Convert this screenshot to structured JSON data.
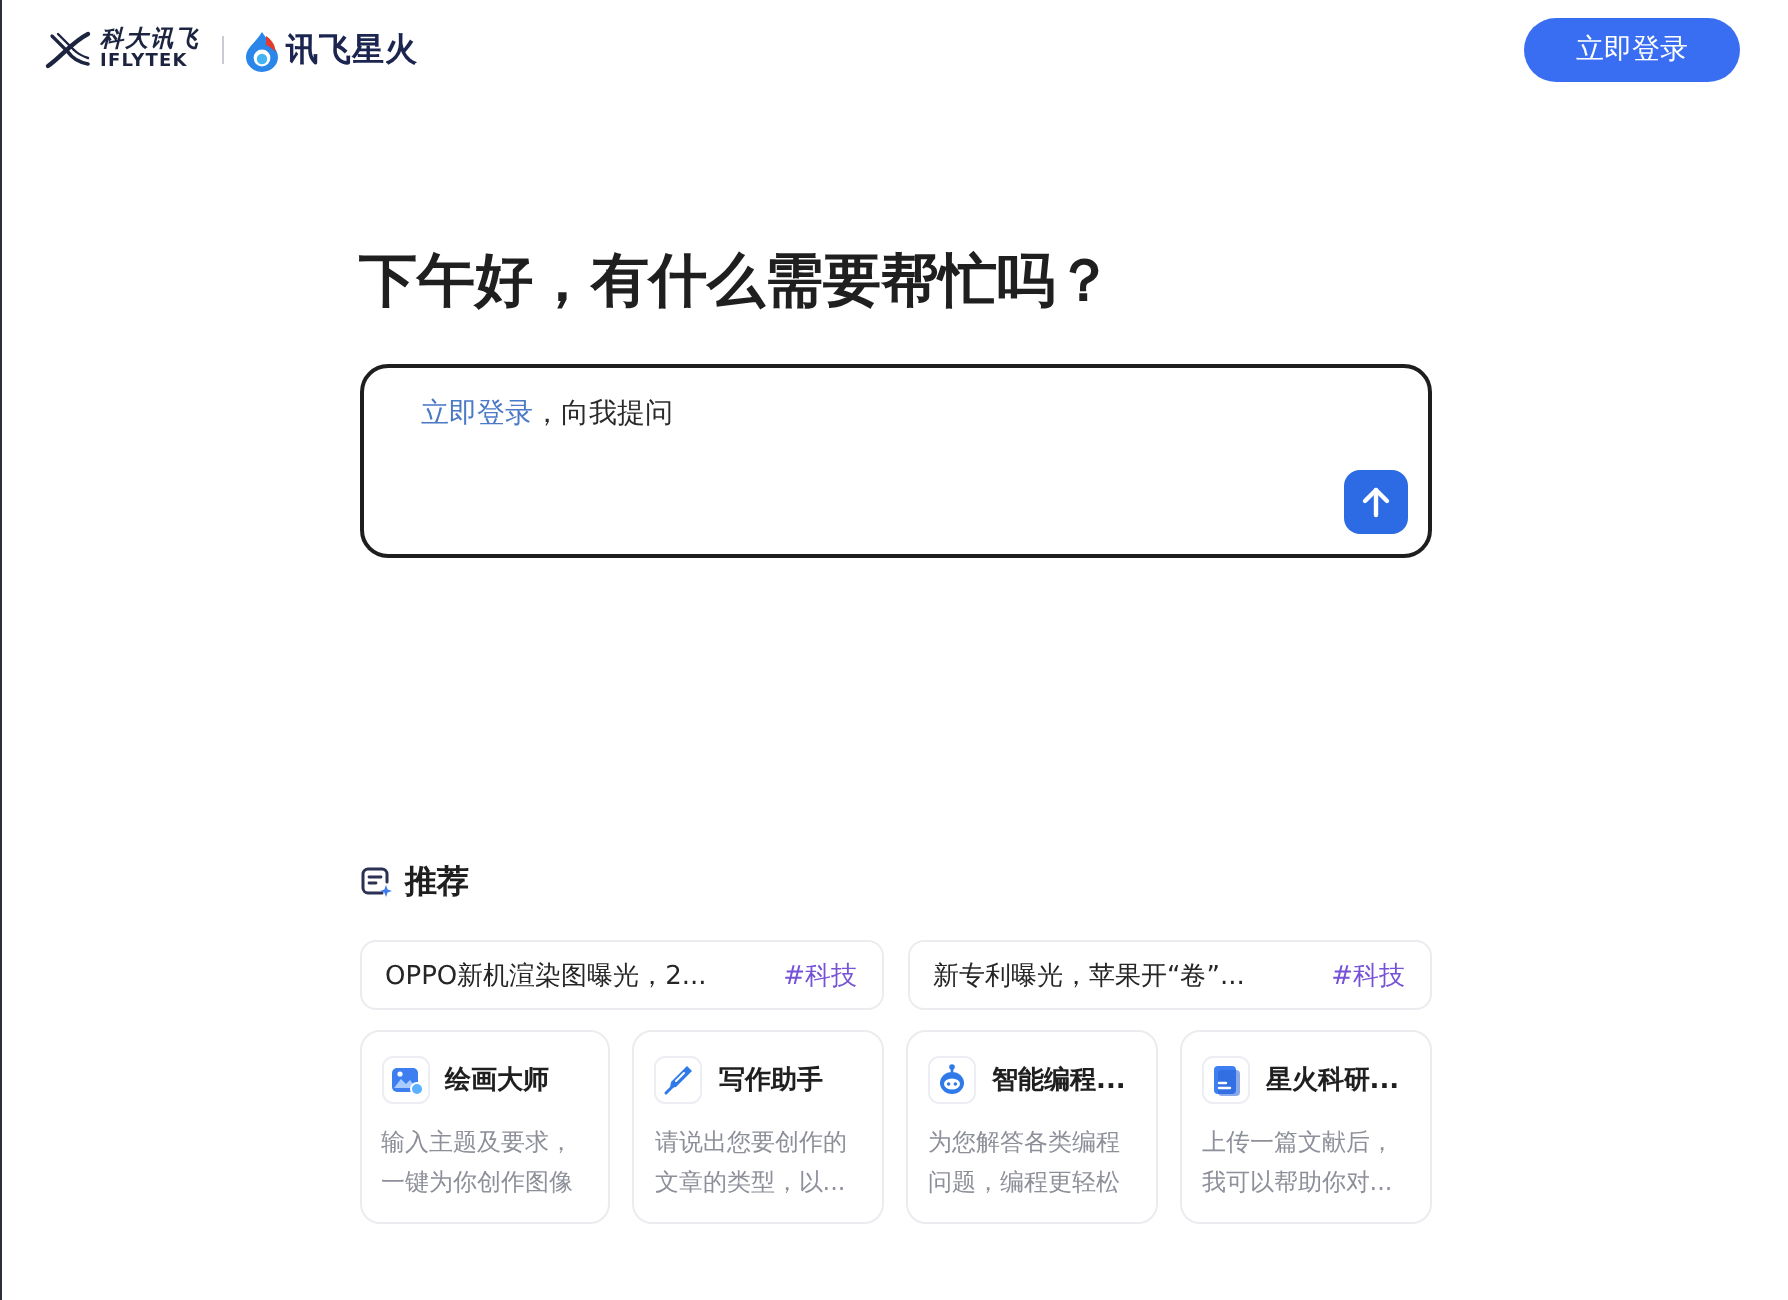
{
  "header": {
    "brand": {
      "name_cn": "科大讯飞",
      "name_en": "IFLYTEK"
    },
    "product": {
      "name": "讯飞星火"
    },
    "login_button": "立即登录"
  },
  "greeting": "下午好，有什么需要帮忙吗？",
  "prompt_box": {
    "login_link": "立即登录",
    "placeholder": "，向我提问"
  },
  "recommend": {
    "title": "推荐",
    "news": [
      {
        "text": "OPPO新机渲染图曝光，2...",
        "tag": "#科技"
      },
      {
        "text": "新专利曝光，苹果开“卷”...",
        "tag": "#科技"
      }
    ],
    "tools": [
      {
        "kind": "paint",
        "title": "绘画大师",
        "description": "输入主题及要求，一键为你创作图像"
      },
      {
        "kind": "pen",
        "title": "写作助手",
        "description": "请说出您要创作的文章的类型，以..."
      },
      {
        "kind": "robot",
        "title": "智能编程...",
        "description": "为您解答各类编程问题，编程更轻松"
      },
      {
        "kind": "document",
        "title": "星火科研...",
        "description": "上传一篇文献后，我可以帮助你对..."
      }
    ]
  }
}
